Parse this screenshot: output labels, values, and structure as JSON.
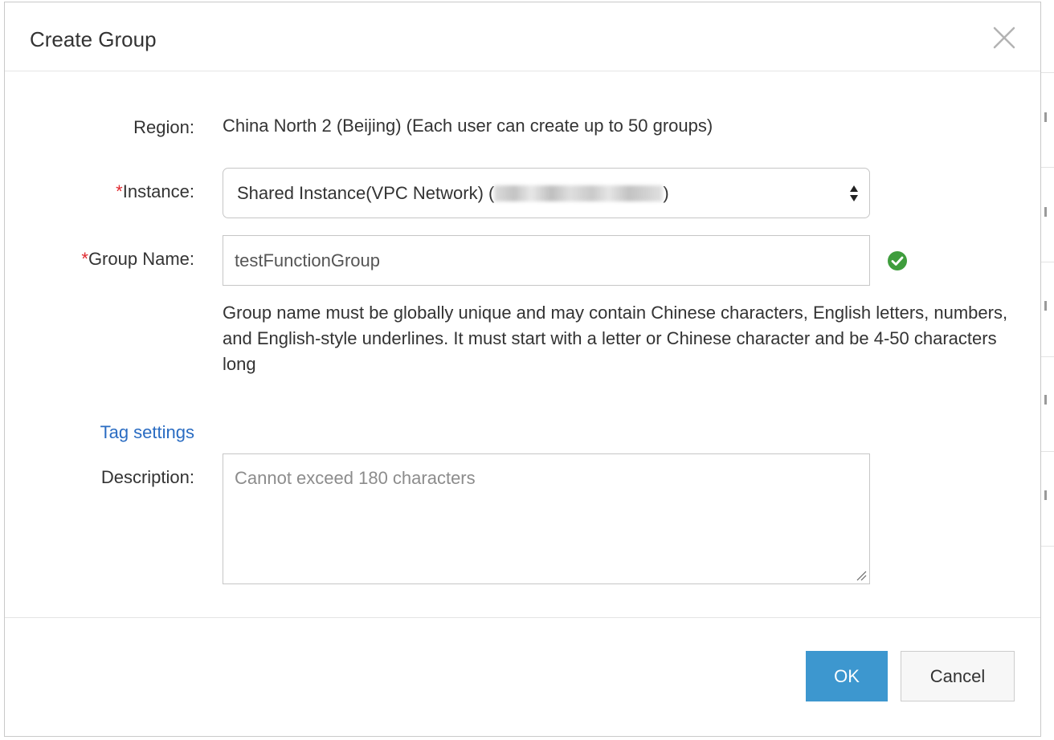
{
  "dialog": {
    "title": "Create Group"
  },
  "form": {
    "region": {
      "label": "Region:",
      "value": "China North 2 (Beijing) (Each user can create up to 50 groups)"
    },
    "instance": {
      "required_mark": "*",
      "label": "Instance:",
      "selected_prefix": "Shared Instance(VPC Network) (",
      "selected_suffix": ")"
    },
    "group_name": {
      "required_mark": "*",
      "label": "Group Name:",
      "value": "testFunctionGroup",
      "valid": true,
      "help_text": "Group name must be globally unique and may contain Chinese characters, English letters, numbers, and English-style underlines. It must start with a letter or Chinese character and be 4-50 characters long"
    },
    "tag_settings": {
      "link_text": "Tag settings"
    },
    "description": {
      "label": "Description:",
      "placeholder": "Cannot exceed 180 characters"
    }
  },
  "buttons": {
    "ok": "OK",
    "cancel": "Cancel"
  },
  "colors": {
    "primary": "#3d97cf",
    "link": "#2a6cc2",
    "required": "#e0282e",
    "valid": "#3f9d3d"
  },
  "icons": {
    "close": "close-icon",
    "select": "select-arrows-icon",
    "valid": "check-circle-icon",
    "resize": "resize-grip-icon"
  }
}
